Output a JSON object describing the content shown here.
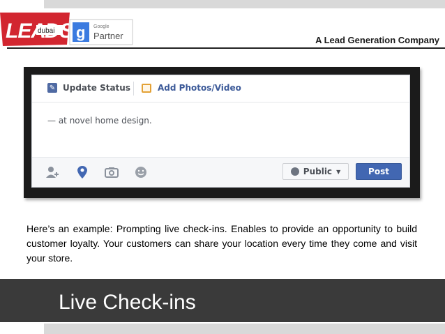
{
  "header": {
    "logo_text": "LEADS",
    "logo_sub": "dubai",
    "google_label": "Google",
    "partner_label": "Partner",
    "tagline": "A Lead Generation Company"
  },
  "composer": {
    "tab_update": "Update Status",
    "tab_photo": "Add Photos/Video",
    "post_text": "— at novel home design.",
    "privacy_label": "Public",
    "post_button": "Post",
    "actions": [
      "tag-friends-icon",
      "location-pin-icon",
      "camera-icon",
      "feeling-smiley-icon"
    ]
  },
  "body": {
    "paragraph": "Here’s an example: Prompting live check-ins. Enables to provide an opportunity to build customer loyalty.  Your customers can share your location every time they come and visit your store."
  },
  "title": {
    "text": "Live Check-ins"
  },
  "colors": {
    "leads_red": "#d22630",
    "facebook_blue": "#4267b2",
    "title_band": "#3a3a3a",
    "accent_bar": "#d9d9d9"
  }
}
